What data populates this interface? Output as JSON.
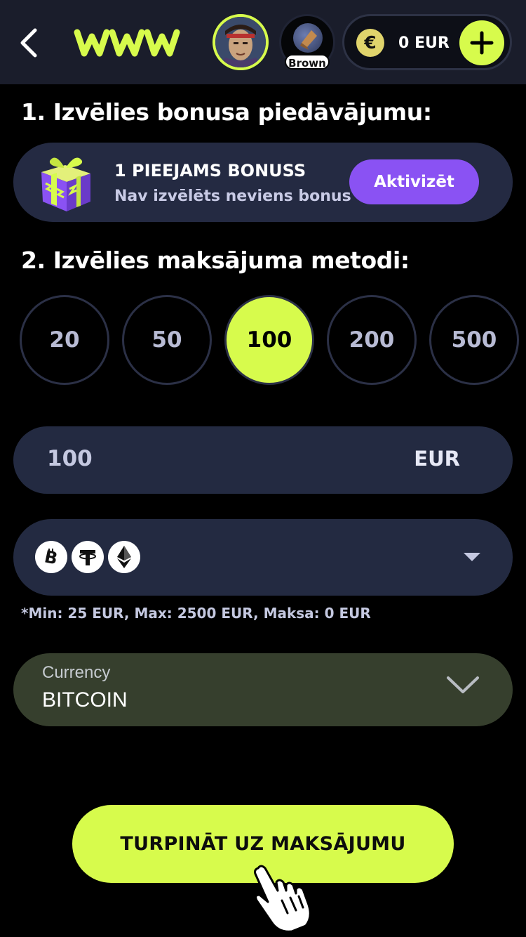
{
  "header": {
    "back_icon": "chevron-left-icon",
    "logo_text": "www",
    "avatar_icon": "player-avatar",
    "level_badge": "Brown",
    "wallet_currency_symbol": "€",
    "wallet_amount": "0 EUR",
    "add_funds_icon": "plus-icon"
  },
  "step1": {
    "title": "1. Izvēlies bonusa piedāvājumu:",
    "bonus_title": "1 PIEEJAMS BONUSS",
    "bonus_subtitle": "Nav izvēlēts neviens bonus",
    "activate_label": "Aktivizēt",
    "gift_icon": "gift-icon"
  },
  "step2": {
    "title": "2. Izvēlies maksājuma metodi:",
    "amount_options": [
      "20",
      "50",
      "100",
      "200",
      "500"
    ],
    "selected_amount": "100"
  },
  "amount_field": {
    "value": "100",
    "unit": "EUR"
  },
  "payment_method": {
    "icons": [
      "bitcoin-icon",
      "tether-icon",
      "ethereum-icon"
    ],
    "dropdown_icon": "caret-down-icon"
  },
  "limits_text": "*Min: 25 EUR, Max: 2500 EUR, Maksa: 0 EUR",
  "currency_select": {
    "label": "Currency",
    "value": "BITCOIN"
  },
  "continue_label": "TURPINĀT UZ MAKSĀJUMU",
  "colors": {
    "accent": "#d7fb4c",
    "purple": "#8a52f3",
    "card": "#232a41",
    "currency_bg": "#363f2d",
    "topbar": "#1a1d2b"
  }
}
